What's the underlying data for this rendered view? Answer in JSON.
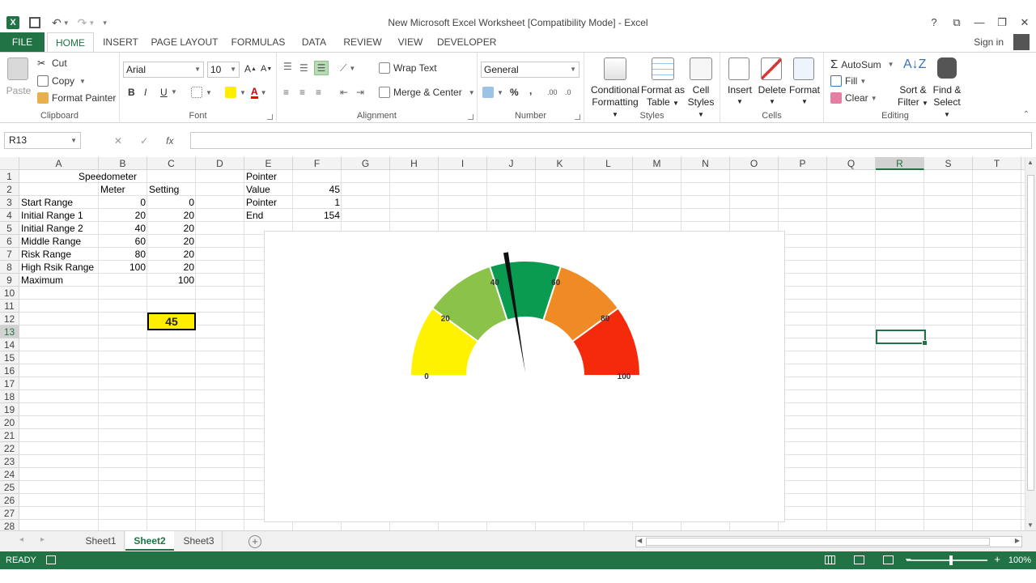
{
  "window": {
    "title": "New Microsoft Excel Worksheet  [Compatibility Mode] - Excel",
    "controls": [
      "?",
      "⧉",
      "—",
      "❐",
      "✕"
    ]
  },
  "tabs": [
    "FILE",
    "HOME",
    "INSERT",
    "PAGE LAYOUT",
    "FORMULAS",
    "DATA",
    "REVIEW",
    "VIEW",
    "DEVELOPER"
  ],
  "signin": "Sign in",
  "ribbon": {
    "clipboard": {
      "paste": "Paste",
      "cut": "Cut",
      "copy": "Copy",
      "format_painter": "Format Painter",
      "label": "Clipboard"
    },
    "font": {
      "name": "Arial",
      "size": "10",
      "bold": "B",
      "italic": "I",
      "underline": "U",
      "label": "Font"
    },
    "alignment": {
      "wrap": "Wrap Text",
      "merge": "Merge & Center",
      "label": "Alignment"
    },
    "number": {
      "format": "General",
      "percent": "%",
      "comma": ",",
      "label": "Number"
    },
    "styles": {
      "conditional_1": "Conditional",
      "conditional_2": "Formatting",
      "format_table_1": "Format as",
      "format_table_2": "Table",
      "cell_styles_1": "Cell",
      "cell_styles_2": "Styles",
      "label": "Styles"
    },
    "cells": {
      "insert": "Insert",
      "delete": "Delete",
      "format": "Format",
      "label": "Cells"
    },
    "editing": {
      "autosum": "AutoSum",
      "fill": "Fill",
      "clear": "Clear",
      "sort_1": "Sort &",
      "sort_2": "Filter",
      "find_1": "Find &",
      "find_2": "Select",
      "label": "Editing"
    }
  },
  "formula_bar": {
    "name_box": "R13",
    "fx": "fx",
    "content": ""
  },
  "columns": [
    "A",
    "B",
    "C",
    "D",
    "E",
    "F",
    "G",
    "H",
    "I",
    "J",
    "K",
    "L",
    "M",
    "N",
    "O",
    "P",
    "Q",
    "R",
    "S",
    "T"
  ],
  "selected_column": "R",
  "rows": [
    "1",
    "2",
    "3",
    "4",
    "5",
    "6",
    "7",
    "8",
    "9",
    "10",
    "11",
    "12",
    "13",
    "14",
    "15",
    "16",
    "17",
    "18",
    "19",
    "20",
    "21",
    "22",
    "23",
    "24",
    "25",
    "26",
    "27",
    "28"
  ],
  "selected_row": "13",
  "sheet": {
    "title": "Speedometer",
    "header_b": "Meter",
    "header_c": "Setting",
    "ranges": [
      {
        "label": "Start Range",
        "meter": "0",
        "setting": "0"
      },
      {
        "label": "Initial Range 1",
        "meter": "20",
        "setting": "20"
      },
      {
        "label": "Initial Range 2",
        "meter": "40",
        "setting": "20"
      },
      {
        "label": "Middle Range",
        "meter": "60",
        "setting": "20"
      },
      {
        "label": "Risk Range",
        "meter": "80",
        "setting": "20"
      },
      {
        "label": "High Rsik Range",
        "meter": "100",
        "setting": "20"
      }
    ],
    "maximum_label": "Maximum",
    "maximum_value": "100",
    "pointer_title": "Pointer",
    "pointer_rows": [
      {
        "label": "Value",
        "value": "45"
      },
      {
        "label": "Pointer",
        "value": "1"
      },
      {
        "label": "End",
        "value": "154"
      }
    ],
    "c12_value": "45"
  },
  "gauge": {
    "segments": [
      {
        "from": 0,
        "to": 20,
        "color": "#fff200"
      },
      {
        "from": 20,
        "to": 40,
        "color": "#8bc34a"
      },
      {
        "from": 40,
        "to": 60,
        "color": "#0a9b50"
      },
      {
        "from": 60,
        "to": 80,
        "color": "#f08a24"
      },
      {
        "from": 80,
        "to": 100,
        "color": "#f52a0a"
      }
    ],
    "tick_labels": [
      "0",
      "20",
      "40",
      "60",
      "80",
      "100"
    ],
    "pointer_value": 45,
    "min": 0,
    "max": 100
  },
  "sheets": [
    "Sheet1",
    "Sheet2",
    "Sheet3"
  ],
  "active_sheet": "Sheet2",
  "status": {
    "ready": "READY",
    "zoom": "100%"
  }
}
